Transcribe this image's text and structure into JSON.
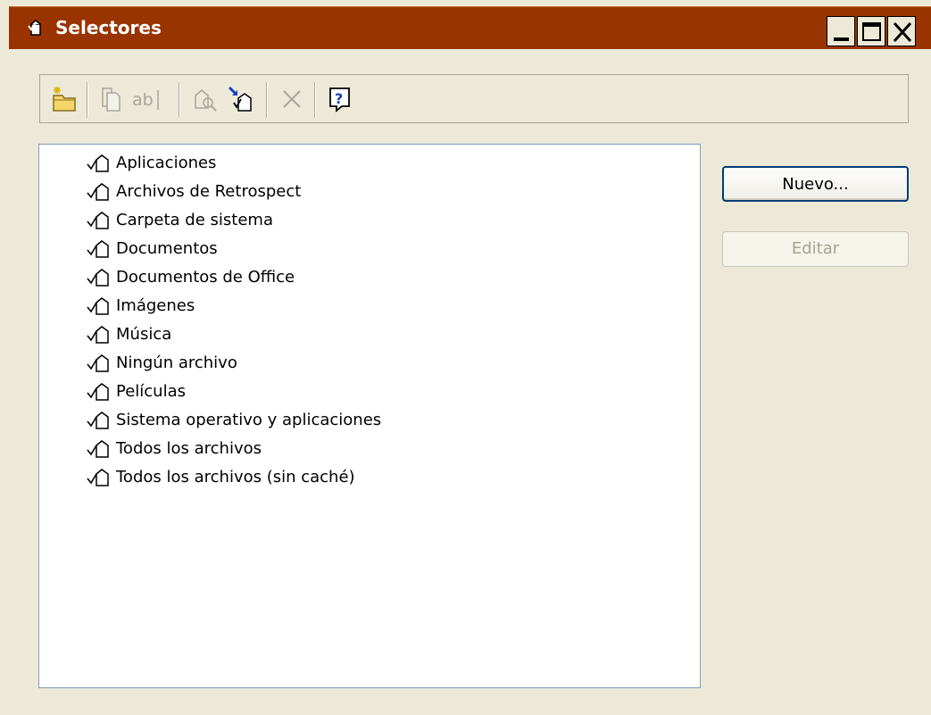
{
  "window": {
    "title": "Selectores",
    "titlebar_color": "#993300",
    "controls": [
      "minimize-icon",
      "maximize-icon",
      "close-icon"
    ]
  },
  "toolbar": {
    "buttons": [
      {
        "icon": "new-folder-icon",
        "enabled": true
      },
      {
        "icon": "copy-icon",
        "enabled": false
      },
      {
        "icon": "rename-icon",
        "text": "ab",
        "enabled": false
      },
      {
        "icon": "edit-icon",
        "enabled": false
      },
      {
        "icon": "import-icon",
        "enabled": true
      },
      {
        "icon": "delete-icon",
        "enabled": false
      },
      {
        "icon": "help-icon",
        "text": "?",
        "enabled": true
      }
    ]
  },
  "list": {
    "items": [
      {
        "label": "Aplicaciones"
      },
      {
        "label": "Archivos de Retrospect"
      },
      {
        "label": "Carpeta de sistema"
      },
      {
        "label": "Documentos"
      },
      {
        "label": "Documentos de Office"
      },
      {
        "label": "Imágenes"
      },
      {
        "label": "Música"
      },
      {
        "label": "Ningún archivo"
      },
      {
        "label": "Películas"
      },
      {
        "label": "Sistema operativo y aplicaciones"
      },
      {
        "label": "Todos los archivos"
      },
      {
        "label": "Todos los archivos (sin caché)"
      }
    ]
  },
  "actions": {
    "new_label": "Nuevo...",
    "edit_label": "Editar"
  }
}
